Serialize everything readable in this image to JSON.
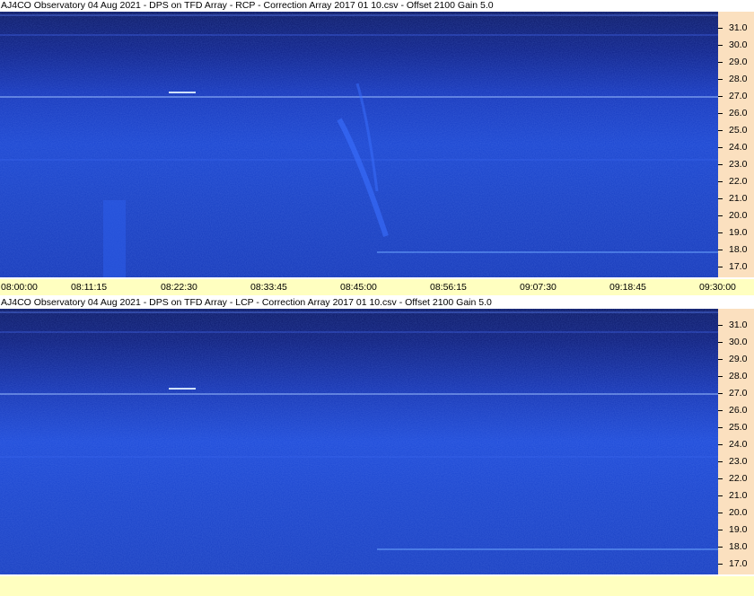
{
  "panels": [
    {
      "title": "AJ4CO Observatory 04 Aug 2021  -  DPS on TFD Array  -  RCP  -  Correction Array 2017 01 10.csv  -  Offset 2100  Gain 5.0",
      "polarization": "RCP"
    },
    {
      "title": "AJ4CO Observatory 04 Aug 2021  -  DPS on TFD Array  -  LCP  -  Correction Array 2017 01 10.csv  -  Offset 2100  Gain 5.0",
      "polarization": "LCP"
    }
  ],
  "freq_labels": [
    "31.0",
    "30.0",
    "29.0",
    "28.0",
    "27.0",
    "26.0",
    "25.0",
    "24.0",
    "23.0",
    "22.0",
    "21.0",
    "20.0",
    "19.0",
    "18.0",
    "17.0"
  ],
  "time_labels": [
    "08:00:00",
    "08:11:15",
    "08:22:30",
    "08:33:45",
    "08:45:00",
    "08:56:15",
    "09:07:30",
    "09:18:45",
    "09:30:00"
  ],
  "colors": {
    "axis_bg": "#fbe0bf",
    "time_axis_bg": "#ffffc0",
    "spectrum_dark": "#0a1a6e",
    "spectrum_light": "#1f55e0"
  }
}
